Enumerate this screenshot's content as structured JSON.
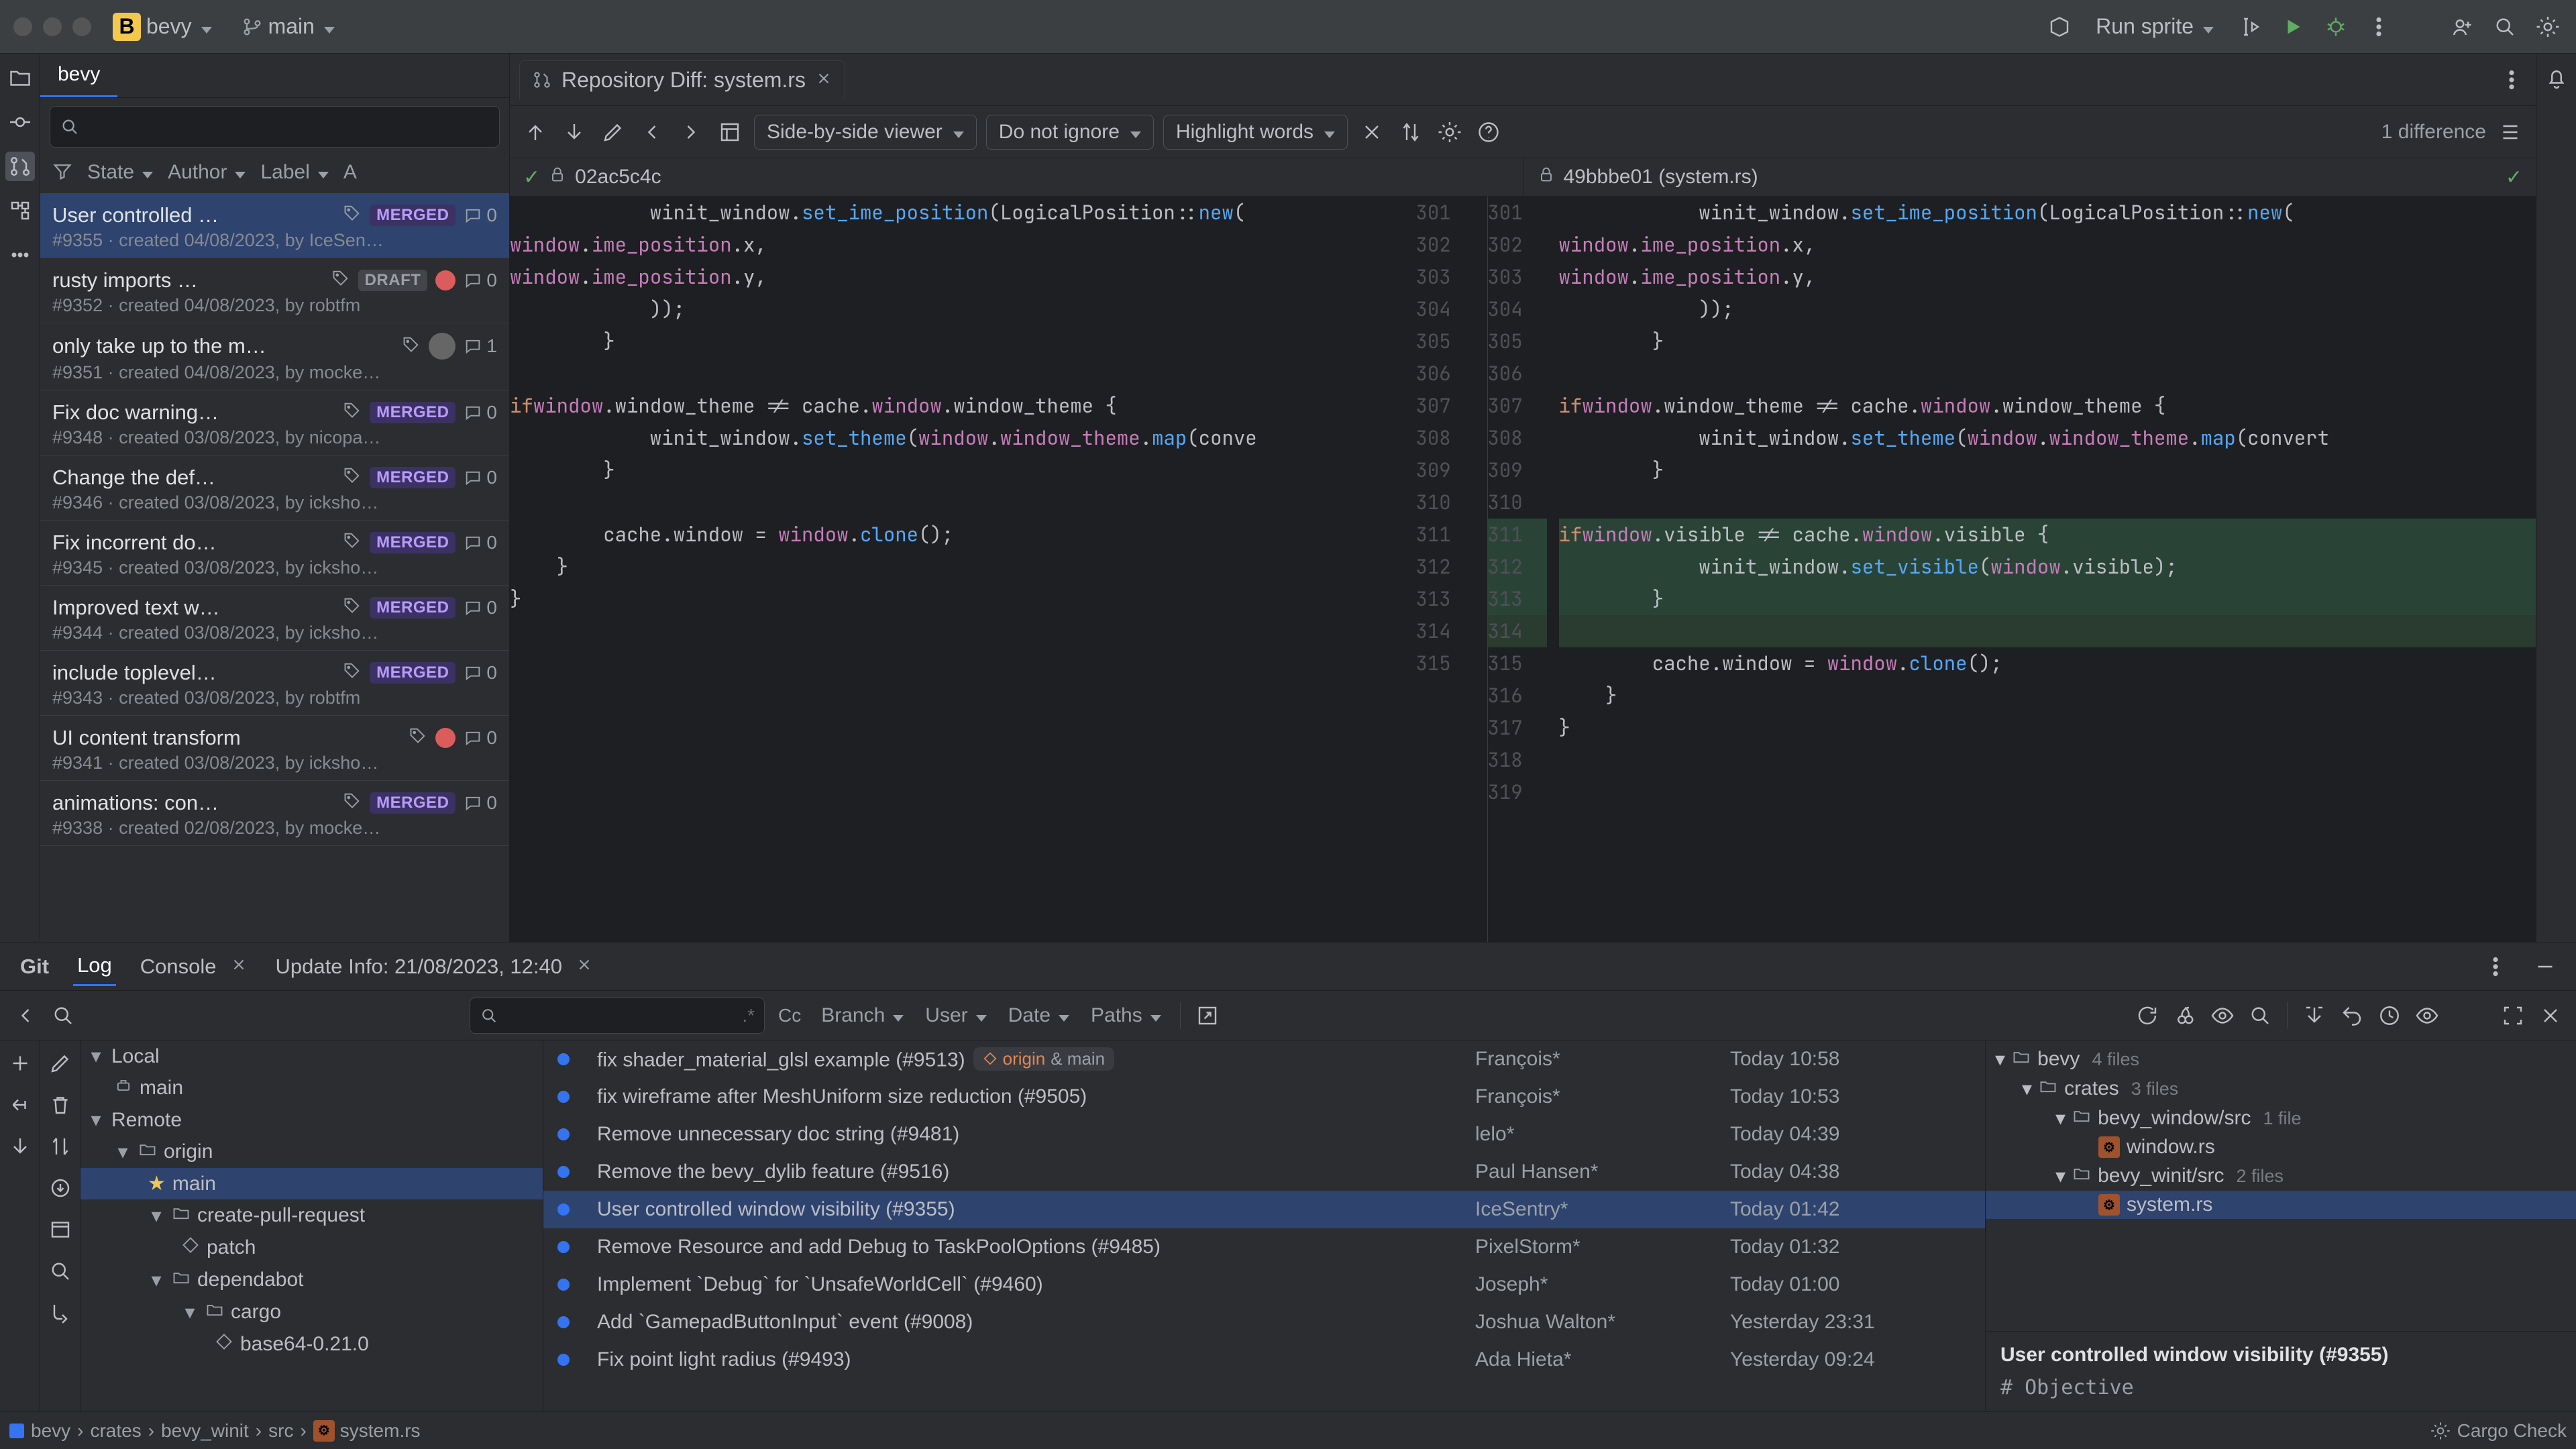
{
  "menubar": {
    "project_initial": "B",
    "project_name": "bevy",
    "branch_name": "main",
    "run_config": "Run sprite"
  },
  "pr_panel": {
    "tab_label": "bevy",
    "filters": {
      "state": "State",
      "author": "Author",
      "label": "Label",
      "assignee": "A"
    },
    "items": [
      {
        "title": "User controlled …",
        "badge": "MERGED",
        "red": false,
        "comments": "0",
        "meta": "#9355 · created 04/08/2023, by IceSen…"
      },
      {
        "title": "rusty imports …",
        "badge": "DRAFT",
        "red": true,
        "comments": "0",
        "meta": "#9352 · created 04/08/2023, by robtfm"
      },
      {
        "title": "only take up to the m…",
        "badge": "",
        "red": false,
        "avatar": true,
        "comments": "1",
        "meta": "#9351 · created 04/08/2023, by mocke…"
      },
      {
        "title": "Fix doc warning…",
        "badge": "MERGED",
        "red": false,
        "comments": "0",
        "meta": "#9348 · created 03/08/2023, by nicopa…"
      },
      {
        "title": "Change the def…",
        "badge": "MERGED",
        "red": false,
        "comments": "0",
        "meta": "#9346 · created 03/08/2023, by icksho…"
      },
      {
        "title": "Fix incorrent do…",
        "badge": "MERGED",
        "red": false,
        "comments": "0",
        "meta": "#9345 · created 03/08/2023, by icksho…"
      },
      {
        "title": "Improved text w…",
        "badge": "MERGED",
        "red": false,
        "comments": "0",
        "meta": "#9344 · created 03/08/2023, by icksho…"
      },
      {
        "title": "include toplevel…",
        "badge": "MERGED",
        "red": false,
        "comments": "0",
        "meta": "#9343 · created 03/08/2023, by robtfm"
      },
      {
        "title": "UI content transform",
        "badge": "",
        "red": true,
        "comments": "0",
        "meta": "#9341 · created 03/08/2023, by icksho…"
      },
      {
        "title": "animations: con…",
        "badge": "MERGED",
        "red": false,
        "comments": "0",
        "meta": "#9338 · created 02/08/2023, by mocke…"
      }
    ]
  },
  "editor": {
    "tab_title": "Repository Diff: system.rs",
    "toolbar": {
      "viewer_mode": "Side-by-side viewer",
      "ignore_mode": "Do not ignore",
      "highlight_mode": "Highlight words",
      "diff_count": "1 difference"
    },
    "left_rev": "02ac5c4c",
    "right_rev": "49bbbe01 (system.rs)",
    "left_lines": [
      {
        "n": "",
        "t": "            winit_window.set_ime_position(LogicalPosition::new("
      },
      {
        "n": "",
        "t": "                window.ime_position.x,"
      },
      {
        "n": "",
        "t": "                window.ime_position.y,"
      },
      {
        "n": "",
        "t": "            ));"
      },
      {
        "n": "",
        "t": "        }"
      },
      {
        "n": "",
        "t": ""
      },
      {
        "n": "",
        "t": "        if window.window_theme != cache.window.window_theme {"
      },
      {
        "n": "",
        "t": "            winit_window.set_theme(window.window_theme.map(conve"
      },
      {
        "n": "",
        "t": "        }"
      },
      {
        "n": "",
        "t": ""
      },
      {
        "n": "",
        "t": "        cache.window = window.clone();"
      },
      {
        "n": "",
        "t": "    }"
      },
      {
        "n": "",
        "t": "}"
      },
      {
        "n": "",
        "t": ""
      },
      {
        "n": "",
        "t": ""
      }
    ],
    "gutter_left": [
      "",
      "",
      "",
      "",
      "",
      "",
      "",
      "",
      "",
      "",
      "",
      "",
      "",
      "",
      ""
    ],
    "gutter_la": [
      "301",
      "302",
      "303",
      "304",
      "305",
      "306",
      "307",
      "308",
      "309",
      "310",
      "311",
      "312",
      "313",
      "314",
      "315"
    ],
    "gutter_ra": [
      "301",
      "302",
      "303",
      "304",
      "305",
      "306",
      "307",
      "308",
      "309",
      "310",
      "311",
      "312",
      "313",
      "314",
      "315",
      "316",
      "317",
      "318",
      "319"
    ],
    "right_lines": [
      {
        "cls": "",
        "t": "            winit_window.set_ime_position(LogicalPosition::new("
      },
      {
        "cls": "",
        "t": "                window.ime_position.x,"
      },
      {
        "cls": "",
        "t": "                window.ime_position.y,"
      },
      {
        "cls": "",
        "t": "            ));"
      },
      {
        "cls": "",
        "t": "        }"
      },
      {
        "cls": "",
        "t": ""
      },
      {
        "cls": "",
        "t": "        if window.window_theme != cache.window.window_theme {"
      },
      {
        "cls": "",
        "t": "            winit_window.set_theme(window.window_theme.map(convert"
      },
      {
        "cls": "",
        "t": "        }"
      },
      {
        "cls": "",
        "t": ""
      },
      {
        "cls": "add",
        "t": "        if window.visible != cache.window.visible {"
      },
      {
        "cls": "add",
        "t": "            winit_window.set_visible(window.visible);"
      },
      {
        "cls": "add",
        "t": "        }"
      },
      {
        "cls": "addsoft",
        "t": ""
      },
      {
        "cls": "",
        "t": "        cache.window = window.clone();"
      },
      {
        "cls": "",
        "t": "    }"
      },
      {
        "cls": "",
        "t": "}"
      },
      {
        "cls": "",
        "t": ""
      },
      {
        "cls": "",
        "t": ""
      }
    ]
  },
  "bottom": {
    "tabs": {
      "git": "Git",
      "log": "Log",
      "console": "Console",
      "update": "Update Info: 21/08/2023, 12:40"
    },
    "logfilters": {
      "branch": "Branch",
      "user": "User",
      "date": "Date",
      "paths": "Paths"
    },
    "search_hint": ".*",
    "cc": "Cc",
    "branches": {
      "local": "Local",
      "local_main": "main",
      "remote": "Remote",
      "origin": "origin",
      "origin_main": "main",
      "cpr": "create-pull-request",
      "patch": "patch",
      "dependabot": "dependabot",
      "cargo": "cargo",
      "base64": "base64-0.21.0"
    },
    "commits": [
      {
        "subj": "fix shader_material_glsl example (#9513)",
        "branch": "origin & main",
        "auth": "François*",
        "date": "Today 10:58"
      },
      {
        "subj": "fix wireframe after MeshUniform size reduction (#9505)",
        "auth": "François*",
        "date": "Today 10:53"
      },
      {
        "subj": "Remove unnecessary doc string (#9481)",
        "auth": "lelo*",
        "date": "Today 04:39"
      },
      {
        "subj": "Remove the bevy_dylib feature (#9516)",
        "auth": "Paul Hansen*",
        "date": "Today 04:38"
      },
      {
        "subj": "User controlled window visibility (#9355)",
        "auth": "IceSentry*",
        "date": "Today 01:42",
        "sel": true
      },
      {
        "subj": "Remove Resource and add Debug to TaskPoolOptions (#9485)",
        "auth": "PixelStorm*",
        "date": "Today 01:32"
      },
      {
        "subj": "Implement `Debug` for `UnsafeWorldCell` (#9460)",
        "auth": "Joseph*",
        "date": "Today 01:00"
      },
      {
        "subj": "Add `GamepadButtonInput` event (#9008)",
        "auth": "Joshua Walton*",
        "date": "Yesterday 23:31"
      },
      {
        "subj": "Fix point light radius (#9493)",
        "auth": "Ada Hieta*",
        "date": "Yesterday 09:24"
      }
    ],
    "detail": {
      "root": "bevy",
      "root_hint": "4 files",
      "crates": "crates",
      "crates_hint": "3 files",
      "bw": "bevy_window/src",
      "bw_hint": "1 file",
      "windowrs": "window.rs",
      "bwi": "bevy_winit/src",
      "bwi_hint": "2 files",
      "systemrs": "system.rs",
      "commit_title": "User controlled window visibility (#9355)",
      "objective": "# Objective"
    }
  },
  "footer": {
    "crumbs": [
      "bevy",
      "crates",
      "bevy_winit",
      "src",
      "system.rs"
    ],
    "cargo": "Cargo Check"
  }
}
